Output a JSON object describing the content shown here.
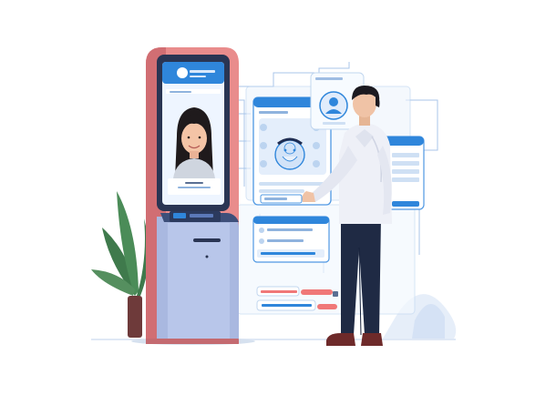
{
  "illustration": {
    "subject": "person-with-kiosk-and-floating-panels",
    "kiosk": {
      "colors": {
        "frame": "#e98c8c",
        "body": "#a9b8e0",
        "screen_bg": "#eef5ff",
        "accent": "#2f86db"
      },
      "screen": {
        "avatar": "woman-avatar"
      }
    },
    "panels": {
      "face_panel": {
        "icon": "face-scan-icon"
      },
      "profile_bubble": {
        "icon": "user-avatar-icon"
      },
      "side_panel": {
        "icon": "form-icon"
      },
      "list_panel": {
        "icon": "list-icon"
      }
    },
    "status_bars": {
      "colors": [
        "#f07878",
        "#2f86db",
        "#f07878"
      ]
    },
    "plant": {
      "color": "#3f7a4c"
    }
  }
}
